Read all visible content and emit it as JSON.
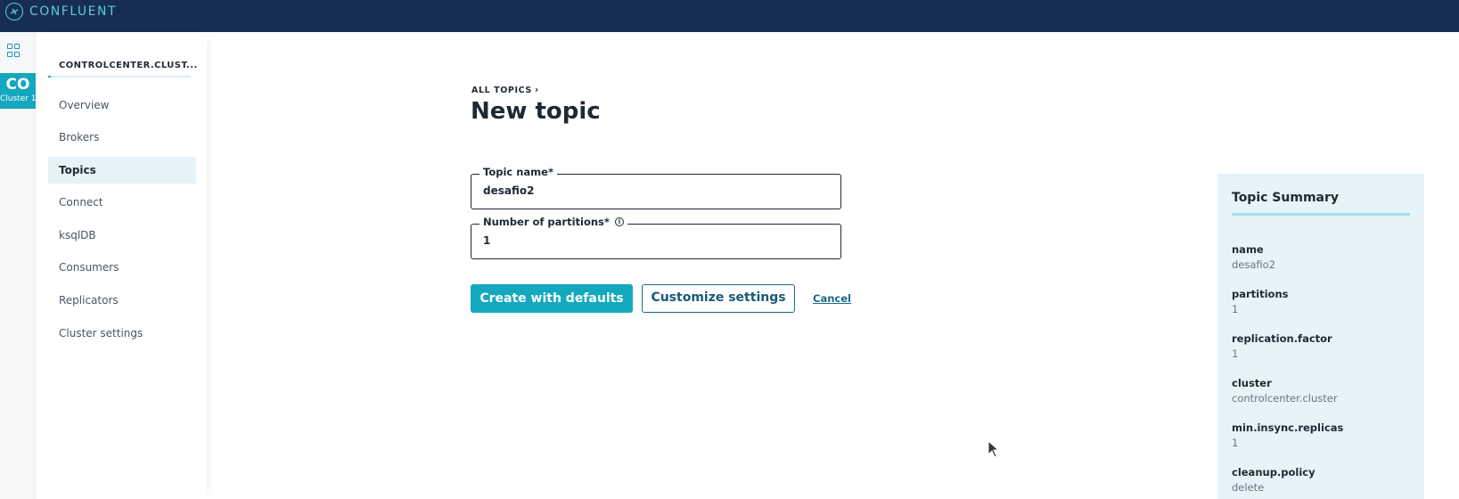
{
  "brand": {
    "name": "CONFLUENT",
    "logo_icon": "confluent-logo-icon"
  },
  "rail": {
    "apps_icon": "grid-icon",
    "cluster_tile": {
      "abbr": "CO",
      "label": "Cluster 1"
    }
  },
  "sidebar": {
    "cluster_name": "CONTROLCENTER.CLUST...",
    "items": [
      {
        "label": "Overview"
      },
      {
        "label": "Brokers"
      },
      {
        "label": "Topics",
        "active": true
      },
      {
        "label": "Connect"
      },
      {
        "label": "ksqlDB"
      },
      {
        "label": "Consumers"
      },
      {
        "label": "Replicators"
      },
      {
        "label": "Cluster settings"
      }
    ]
  },
  "main": {
    "breadcrumb": "ALL TOPICS",
    "title": "New topic",
    "fields": {
      "topic_name": {
        "label": "Topic name*",
        "value": "desafio2"
      },
      "partitions": {
        "label": "Number of partitions*",
        "value": "1",
        "info_icon": "info-icon"
      }
    },
    "buttons": {
      "create": "Create with defaults",
      "customize": "Customize settings",
      "cancel": "Cancel"
    }
  },
  "summary": {
    "title": "Topic Summary",
    "entries": [
      {
        "key": "name",
        "value": "desafio2"
      },
      {
        "key": "partitions",
        "value": "1"
      },
      {
        "key": "replication.factor",
        "value": "1"
      },
      {
        "key": "cluster",
        "value": "controlcenter.cluster"
      },
      {
        "key": "min.insync.replicas",
        "value": "1"
      },
      {
        "key": "cleanup.policy",
        "value": "delete"
      }
    ]
  },
  "colors": {
    "topbar": "#172d53",
    "accent": "#13a8bd",
    "summary_bg": "#e6f3f8"
  }
}
